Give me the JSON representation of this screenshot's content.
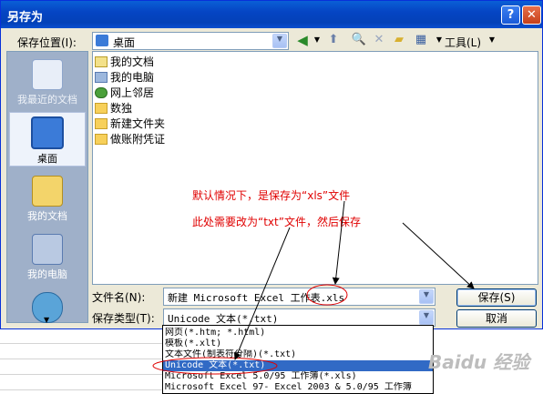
{
  "window": {
    "title": "另存为",
    "help": "?",
    "close": "✕"
  },
  "location": {
    "label": "保存位置(I):",
    "value": "桌面"
  },
  "toolbar": {
    "tools_label": "工具(L)"
  },
  "places": [
    {
      "label": "我最近的文档",
      "icon": "recent-docs-icon"
    },
    {
      "label": "桌面",
      "icon": "desktop-icon"
    },
    {
      "label": "我的文档",
      "icon": "my-documents-icon"
    },
    {
      "label": "我的电脑",
      "icon": "my-computer-icon"
    },
    {
      "label": "",
      "icon": "network-icon"
    }
  ],
  "files": [
    {
      "name": "我的文档",
      "icon": "my-documents-icon"
    },
    {
      "name": "我的电脑",
      "icon": "my-computer-icon"
    },
    {
      "name": "网上邻居",
      "icon": "network-icon"
    },
    {
      "name": "数独",
      "icon": "folder-icon"
    },
    {
      "name": "新建文件夹",
      "icon": "folder-icon"
    },
    {
      "name": "做账附凭证",
      "icon": "folder-icon"
    }
  ],
  "filename": {
    "label": "文件名(N):",
    "value": "新建 Microsoft Excel 工作表.xls"
  },
  "filetype": {
    "label": "保存类型(T):",
    "value": "Unicode 文本(*.txt)"
  },
  "buttons": {
    "save": "保存(S)",
    "cancel": "取消"
  },
  "filetype_options": [
    "网页(*.htm; *.html)",
    "模板(*.xlt)",
    "文本文件(制表符分隔)(*.txt)",
    "Unicode 文本(*.txt)",
    "Microsoft Excel 5.0/95 工作簿(*.xls)",
    "Microsoft Excel 97- Excel 2003 & 5.0/95 工作簿"
  ],
  "annotations": {
    "line1": "默认情况下，是保存为“xls”文件",
    "line2": "此处需要改为“txt”文件，然后保存"
  },
  "watermark": "Baidu 经验",
  "colors": {
    "annotation": "#e00000",
    "selection": "#316ac5",
    "title_bar": "#0545c4"
  }
}
